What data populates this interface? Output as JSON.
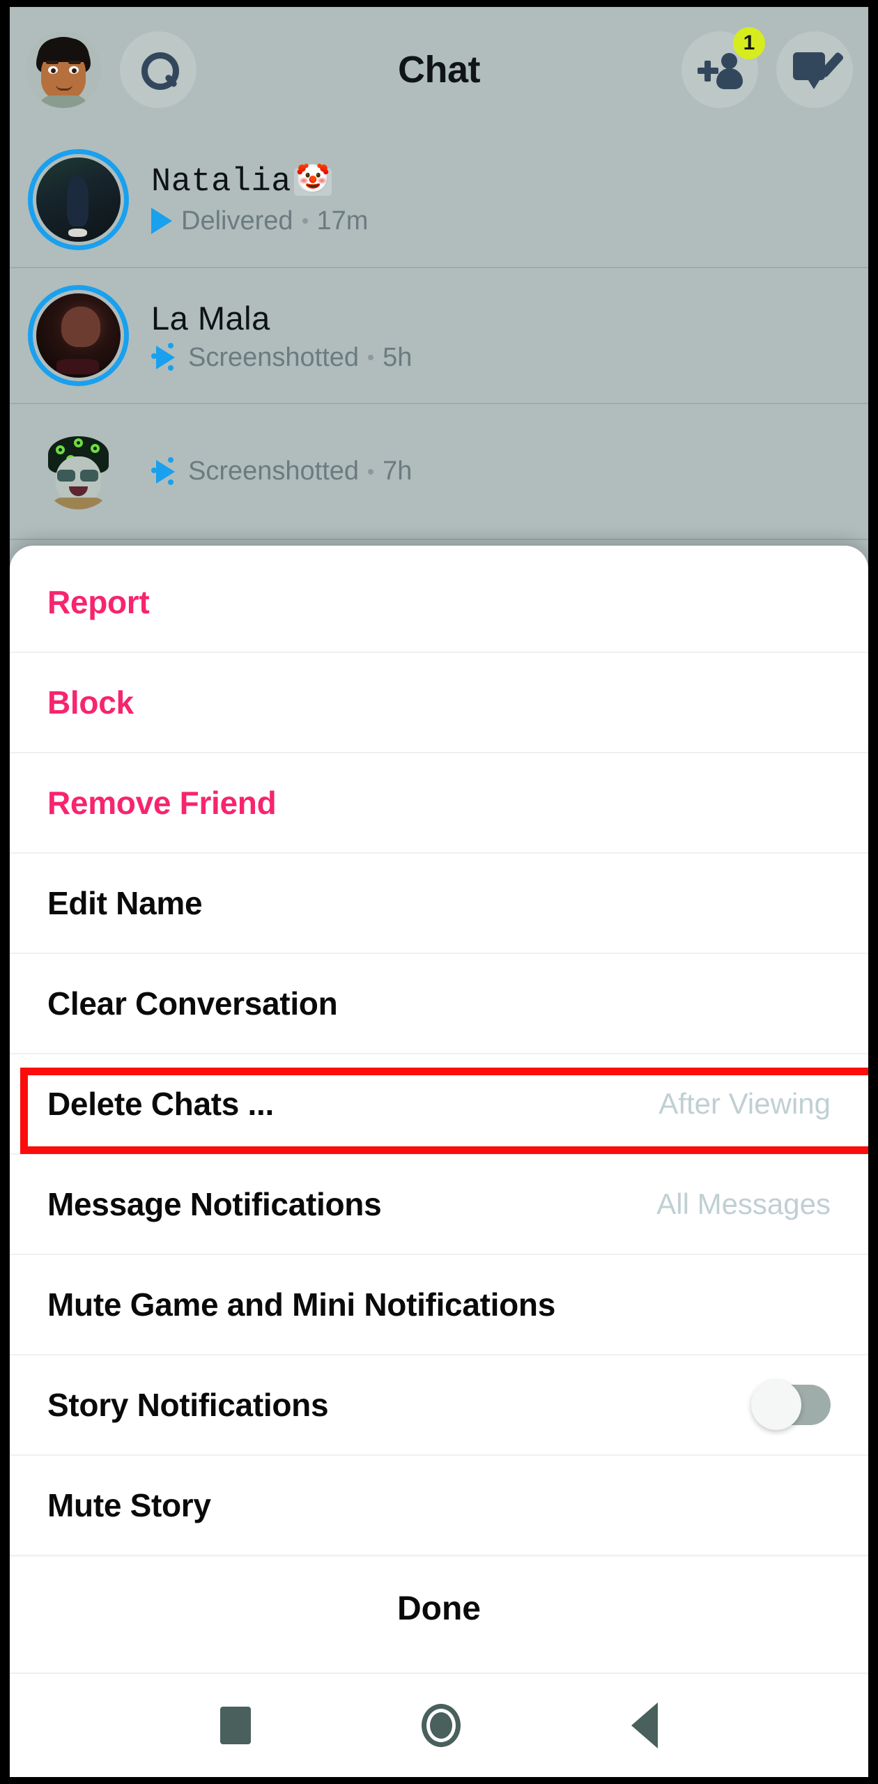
{
  "app": {
    "name": "Snapchat",
    "background_color": "#b0bdbc",
    "accent_blue": "#19a0ee",
    "danger_pink": "#f7246e",
    "badge_color": "#d6ec1f",
    "annotation_color": "#fb0d0d"
  },
  "header": {
    "title": "Chat",
    "avatar_icon": "bitmoji-avatar-icon",
    "search_icon": "search-icon",
    "add_friend_icon": "add-friend-icon",
    "add_friend_badge": "1",
    "new_chat_icon": "new-chat-icon"
  },
  "chat_list": [
    {
      "name": "Natalia",
      "emoji": "🤡",
      "status": "Delivered",
      "time": "17m",
      "status_icon": "delivered-arrow-icon",
      "ring": "unopened-story-ring"
    },
    {
      "name": "La Mala",
      "emoji": "",
      "status": "Screenshotted",
      "time": "5h",
      "status_icon": "screenshot-icon",
      "ring": "unopened-story-ring"
    },
    {
      "name": "",
      "emoji": "",
      "status": "Screenshotted",
      "time": "7h",
      "status_icon": "screenshot-icon",
      "ring": "none"
    }
  ],
  "sheet": {
    "items": [
      {
        "label": "Report",
        "value": "",
        "style": "danger",
        "control": "none"
      },
      {
        "label": "Block",
        "value": "",
        "style": "danger",
        "control": "none"
      },
      {
        "label": "Remove Friend",
        "value": "",
        "style": "danger",
        "control": "none"
      },
      {
        "label": "Edit Name",
        "value": "",
        "style": "normal",
        "control": "none"
      },
      {
        "label": "Clear Conversation",
        "value": "",
        "style": "normal",
        "control": "none"
      },
      {
        "label": "Delete Chats ...",
        "value": "After Viewing",
        "style": "normal",
        "control": "value",
        "highlighted": true
      },
      {
        "label": "Message Notifications",
        "value": "All Messages",
        "style": "normal",
        "control": "value"
      },
      {
        "label": "Mute Game and Mini Notifications",
        "value": "",
        "style": "normal",
        "control": "none"
      },
      {
        "label": "Story Notifications",
        "value": "",
        "style": "normal",
        "control": "toggle",
        "toggle_on": false
      },
      {
        "label": "Mute Story",
        "value": "",
        "style": "normal",
        "control": "none"
      }
    ],
    "done_label": "Done"
  },
  "navbar": {
    "recents_icon": "square-recents-icon",
    "home_icon": "circle-home-icon",
    "back_icon": "triangle-back-icon"
  }
}
